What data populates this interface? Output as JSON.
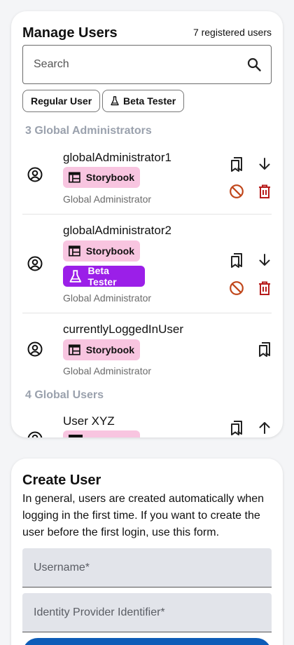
{
  "manage": {
    "title": "Manage Users",
    "count_label": "7 registered users",
    "search_placeholder": "Search",
    "filters": [
      {
        "label": "Regular User"
      },
      {
        "label": "Beta Tester",
        "icon": "flask-icon"
      }
    ],
    "sections": [
      {
        "title": "3 Global Administrators",
        "users": [
          {
            "name": "globalAdministrator1",
            "badges": [
              "Storybook"
            ],
            "role": "Global Administrator",
            "actions": [
              "bookmark-icon",
              "arrow-down-icon",
              "ban-icon",
              "delete-icon"
            ]
          },
          {
            "name": "globalAdministrator2",
            "badges": [
              "Storybook",
              "Beta Tester"
            ],
            "role": "Global Administrator",
            "actions": [
              "bookmark-icon",
              "arrow-down-icon",
              "ban-icon",
              "delete-icon"
            ]
          },
          {
            "name": "currentlyLoggedInUser",
            "badges": [
              "Storybook"
            ],
            "role": "Global Administrator",
            "actions": [
              "bookmark-icon"
            ]
          }
        ]
      },
      {
        "title": "4 Global Users",
        "users": [
          {
            "name": "User XYZ",
            "actions": [
              "bookmark-icon",
              "arrow-up-icon"
            ]
          }
        ]
      }
    ]
  },
  "create": {
    "title": "Create User",
    "description": "In general, users are created automatically when logging in the first time. If you want to create the user before the first login, use this form.",
    "username_placeholder": "Username*",
    "idp_placeholder": "Identity Provider Identifier*"
  },
  "colors": {
    "storybook_badge": "#f8c5e0",
    "beta_badge": "#9b1fe8",
    "ban_icon": "#c0461a",
    "delete_icon": "#b71c1c",
    "section_title": "#9aa1ad",
    "primary_button": "#0d5cb8"
  }
}
